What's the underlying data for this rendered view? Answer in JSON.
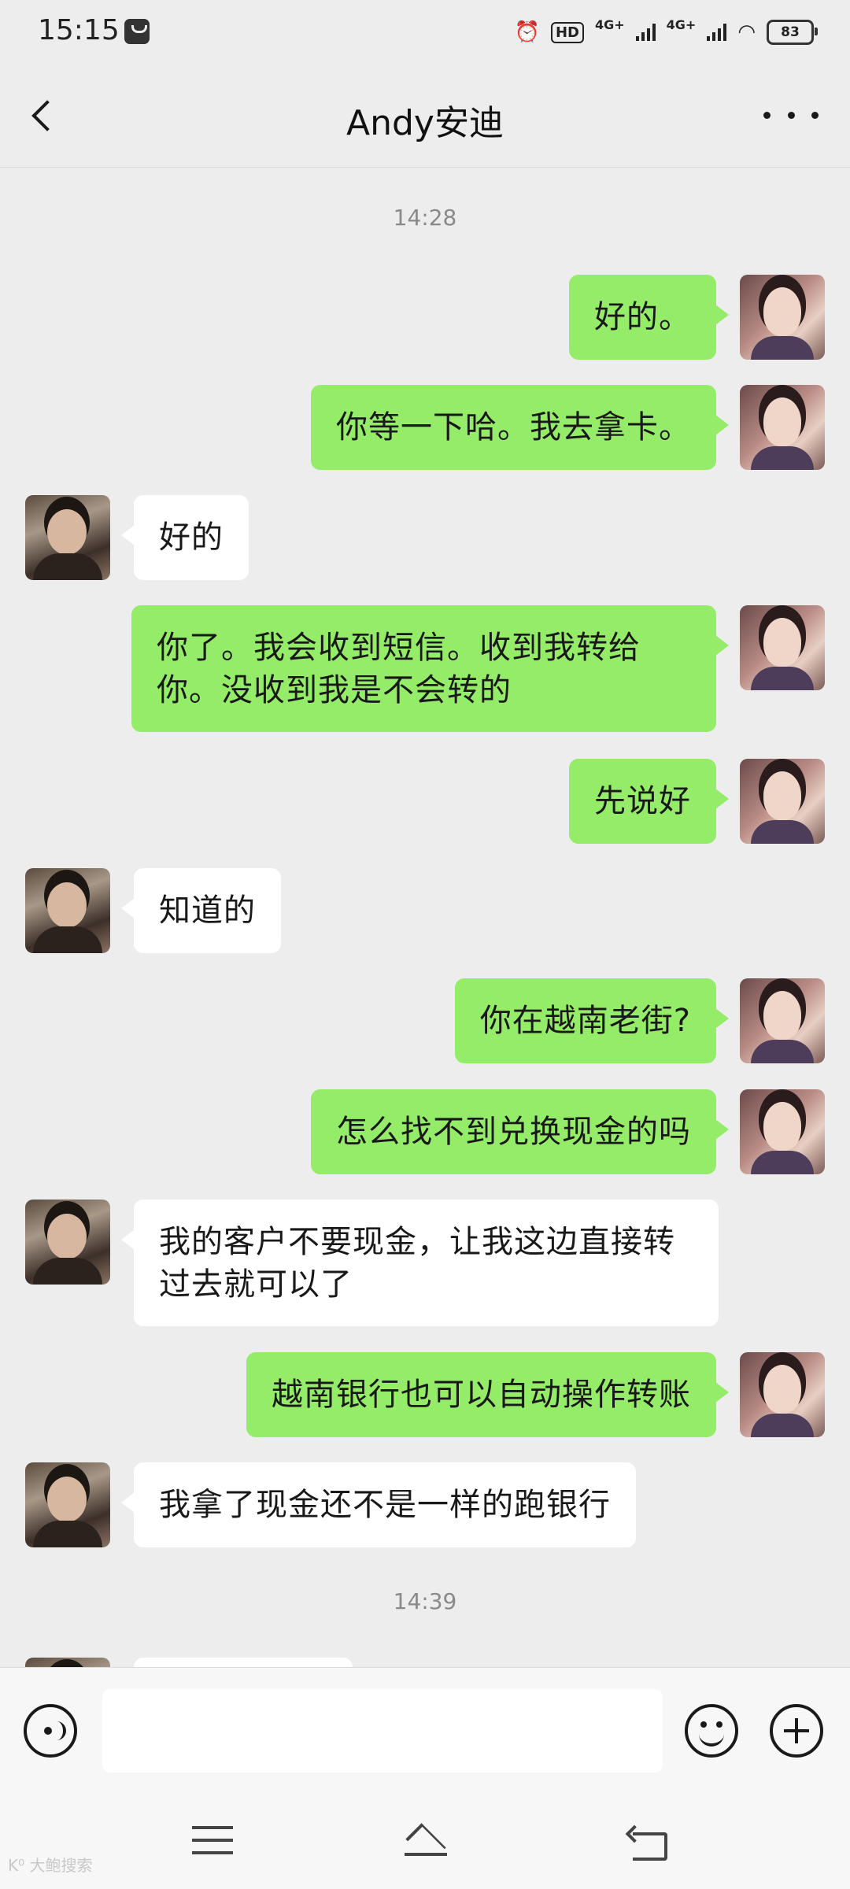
{
  "status_bar": {
    "time": "15:15",
    "hd_label": "HD",
    "network_1": "4G+",
    "network_2": "4G+",
    "battery": "83",
    "icons": [
      "notification-icon",
      "alarm-icon",
      "wifi-icon"
    ]
  },
  "header": {
    "title": "Andy安迪",
    "back_icon": "chevron-left-icon",
    "more_icon": "more-dots-icon"
  },
  "chat": {
    "timestamps": [
      "14:28",
      "14:39"
    ],
    "messages": [
      {
        "from": "me",
        "text": "好的。"
      },
      {
        "from": "me",
        "text": "你等一下哈。我去拿卡。"
      },
      {
        "from": "them",
        "text": "好的"
      },
      {
        "from": "me",
        "text": "你了。我会收到短信。收到我转给你。没收到我是不会转的"
      },
      {
        "from": "me",
        "text": "先说好"
      },
      {
        "from": "them",
        "text": "知道的"
      },
      {
        "from": "me",
        "text": "你在越南老街?"
      },
      {
        "from": "me",
        "text": "怎么找不到兑换现金的吗"
      },
      {
        "from": "them",
        "text": "我的客户不要现金，让我这边直接转过去就可以了"
      },
      {
        "from": "me",
        "text": "越南银行也可以自动操作转账"
      },
      {
        "from": "them",
        "text": "我拿了现金还不是一样的跑银行"
      }
    ]
  },
  "input_bar": {
    "placeholder": "",
    "voice_icon": "voice-icon",
    "emoji_icon": "emoji-icon",
    "plus_icon": "plus-icon"
  },
  "nav_bar": {
    "icons": [
      "menu-icon",
      "home-icon",
      "back-nav-icon"
    ],
    "watermark": "K⁰ 大鲍搜索"
  }
}
